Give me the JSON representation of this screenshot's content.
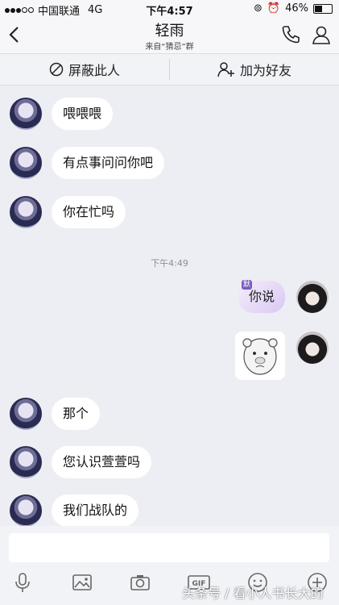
{
  "status_bar": {
    "carrier": "中国联通",
    "network": "4G",
    "time": "下午4:57",
    "battery": "46%"
  },
  "header": {
    "title": "轻雨",
    "subtitle": "来自“猜忌”群"
  },
  "actions": {
    "block": "屏蔽此人",
    "add_friend": "加为好友"
  },
  "messages": {
    "m1": "喂喂喂",
    "m2": "有点事问问你吧",
    "m3": "你在忙吗",
    "timestamp": "下午4:49",
    "mine1_tag": "默",
    "mine1": "你说",
    "m4": "那个",
    "m5": "您认识萱萱吗",
    "m6": "我们战队的"
  },
  "watermark": "头条号 / 看小人书长大的",
  "colors": {
    "accent_purple": "#7a5bc0",
    "bubble_white": "#ffffff",
    "background": "#eceef3"
  }
}
